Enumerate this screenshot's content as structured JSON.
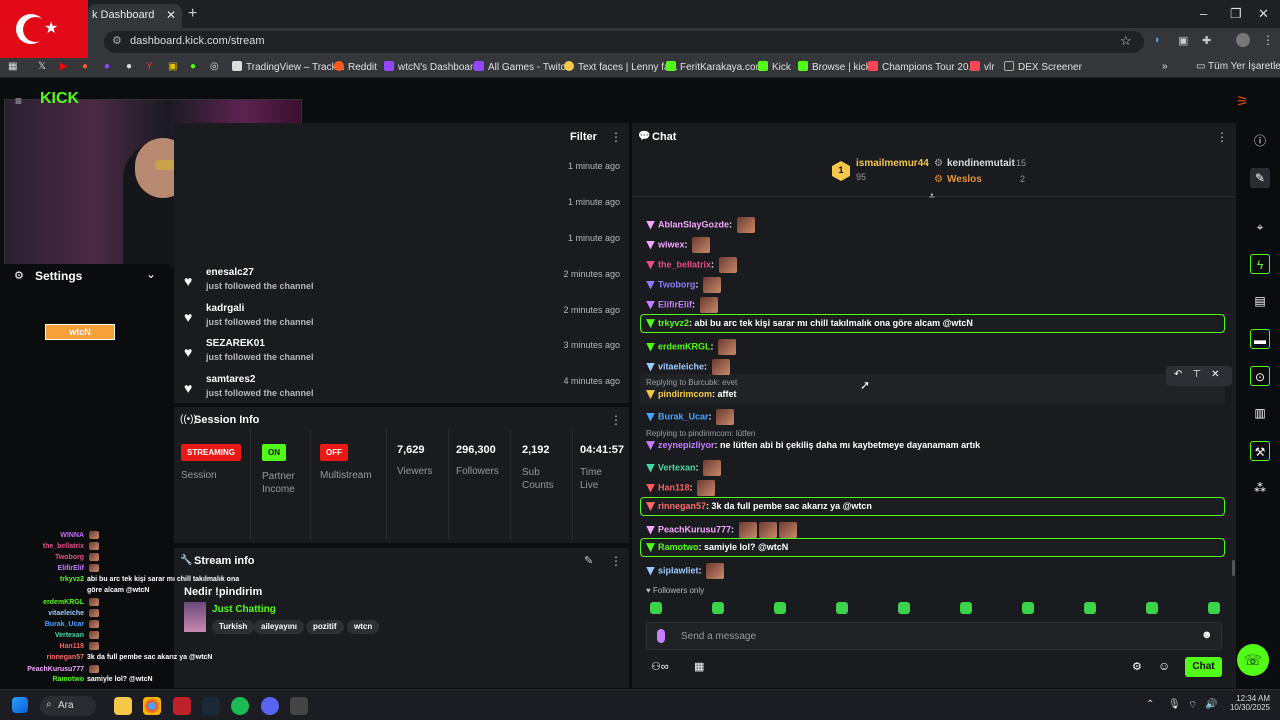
{
  "browser": {
    "tab_title": "k Dashboard",
    "url": "dashboard.kick.com/stream",
    "bookmarks": [
      "TradingView – Track...",
      "Reddit",
      "wtcN's Dashboard",
      "All Games - Twitch",
      "Text faces | Lenny fa...",
      "FeritKarakaya.com",
      "Kick",
      "Browse | kick",
      "Champions Tour 20...",
      "vlr",
      "DEX Screener",
      "Tüm Yer İşaretleri"
    ]
  },
  "feed": {
    "filter_label": "Filter",
    "rows": [
      {
        "user": "",
        "action": "",
        "time": "1 minute ago"
      },
      {
        "user": "",
        "action": "",
        "time": "1 minute ago"
      },
      {
        "user": "",
        "action": "",
        "time": "1 minute ago"
      },
      {
        "user": "enesalc27",
        "action": "just followed the channel",
        "time": "2 minutes ago"
      },
      {
        "user": "kadrgali",
        "action": "just followed the channel",
        "time": "2 minutes ago"
      },
      {
        "user": "SEZAREK01",
        "action": "just followed the channel",
        "time": "3 minutes ago"
      },
      {
        "user": "samtares2",
        "action": "just followed the channel",
        "time": "4 minutes ago"
      }
    ]
  },
  "settings": {
    "label": "Settings",
    "logo_text": "wtcN"
  },
  "session": {
    "title": "Session Info",
    "streaming": "STREAMING",
    "session_label": "Session",
    "on": "ON",
    "partner_label": "Partner Income",
    "off": "OFF",
    "multistream_label": "Multistream",
    "viewers": "7,629",
    "viewers_label": "Viewers",
    "followers": "296,300",
    "followers_label": "Followers",
    "subs": "2,192",
    "subs_label": "Sub Counts",
    "time": "04:41:57",
    "time_label": "Time Live"
  },
  "stream_info": {
    "title": "Stream info",
    "stream_title": "Nedir !pindirim",
    "category": "Just Chatting",
    "tags": [
      "Turkish",
      "aileyayını",
      "pozitif",
      "wtcn"
    ]
  },
  "chat": {
    "title": "Chat",
    "leader1": {
      "name": "ismailmemur44",
      "value": "95",
      "rank": "1"
    },
    "leader2": {
      "name": "kendinemutait",
      "value": "15"
    },
    "leader3": {
      "name": "Weslos",
      "value": "2"
    },
    "messages": [
      {
        "user": "AblanSlayGozde",
        "color": "#f6a6ff",
        "text": ""
      },
      {
        "user": "wiwex",
        "color": "#f6a6ff",
        "text": ""
      },
      {
        "user": "the_bellatrix",
        "color": "#e34f8a",
        "text": ""
      },
      {
        "user": "Twoborg",
        "color": "#8b7cff",
        "text": ""
      },
      {
        "user": "ElifirElif",
        "color": "#c77dff",
        "text": ""
      },
      {
        "user": "trkyvz2",
        "color": "#53fc18",
        "text": "abi bu arc tek kişi sarar mı chill takılmalık ona göre alcam @wtcN"
      },
      {
        "user": "erdemKRGL",
        "color": "#53fc18",
        "text": ""
      },
      {
        "user": "vitaeleiche",
        "color": "#9ecbff",
        "text": ""
      },
      {
        "user": "pindirimcom",
        "color": "#f6c84a",
        "text": "affet"
      },
      {
        "user": "Burak_Ucar",
        "color": "#4aa3ff",
        "text": ""
      },
      {
        "user": "zeynepizliyor",
        "color": "#c77dff",
        "text": "ne lütfen abi bi çekiliş daha mı kaybetmeye dayanamam artık"
      },
      {
        "user": "Vertexan",
        "color": "#4ad9a6",
        "text": ""
      },
      {
        "user": "Han118",
        "color": "#ff5c5c",
        "text": ""
      },
      {
        "user": "rinnegan57",
        "color": "#ff6b6b",
        "text": "3k da full pembe sac akarız ya @wtcn"
      },
      {
        "user": "PeachKurusu777",
        "color": "#f6a6ff",
        "text": ""
      },
      {
        "user": "Ramotwo",
        "color": "#53fc18",
        "text": "samiyle lol? @wtcN"
      },
      {
        "user": "siplawliet",
        "color": "#9ecbff",
        "text": ""
      }
    ],
    "reply1": "Replying to Burcubk: evet",
    "reply2": "Replying to pindirimcom: lütfen",
    "followers_only": "Followers only",
    "placeholder": "Send a message",
    "send_label": "Chat"
  },
  "overlay_chat": [
    {
      "user": "WINNA",
      "color": "#c76dff",
      "text": ""
    },
    {
      "user": "the_bellatrix",
      "color": "#e34f8a",
      "text": ""
    },
    {
      "user": "Twoborg",
      "color": "#e34f8a",
      "text": ""
    },
    {
      "user": "ElifirElif",
      "color": "#c77dff",
      "text": ""
    },
    {
      "user": "trkyvz2",
      "color": "#53fc18",
      "text": "abi bu arc tek kişi sarar mı chill takılmalık ona"
    },
    {
      "user": "",
      "color": "#fff",
      "text": "göre alcam @wtcN"
    },
    {
      "user": "erdemKRGL",
      "color": "#53fc18",
      "text": ""
    },
    {
      "user": "vitaeleiche",
      "color": "#9ecbff",
      "text": ""
    },
    {
      "user": "Burak_Ucar",
      "color": "#4aa3ff",
      "text": ""
    },
    {
      "user": "Vertexan",
      "color": "#4ad9a6",
      "text": ""
    },
    {
      "user": "Han118",
      "color": "#ff5c5c",
      "text": ""
    },
    {
      "user": "rinnegan57",
      "color": "#ff6b6b",
      "text": "3k da full pembe sac akarız ya @wtcN"
    },
    {
      "user": "PeachKurusu777",
      "color": "#f6a6ff",
      "text": ""
    },
    {
      "user": "Ramotwo",
      "color": "#53fc18",
      "text": "samiyle lol? @wtcN"
    }
  ],
  "taskbar": {
    "search": "Ara",
    "time": "12:34 AM",
    "date": "10/30/2025"
  }
}
